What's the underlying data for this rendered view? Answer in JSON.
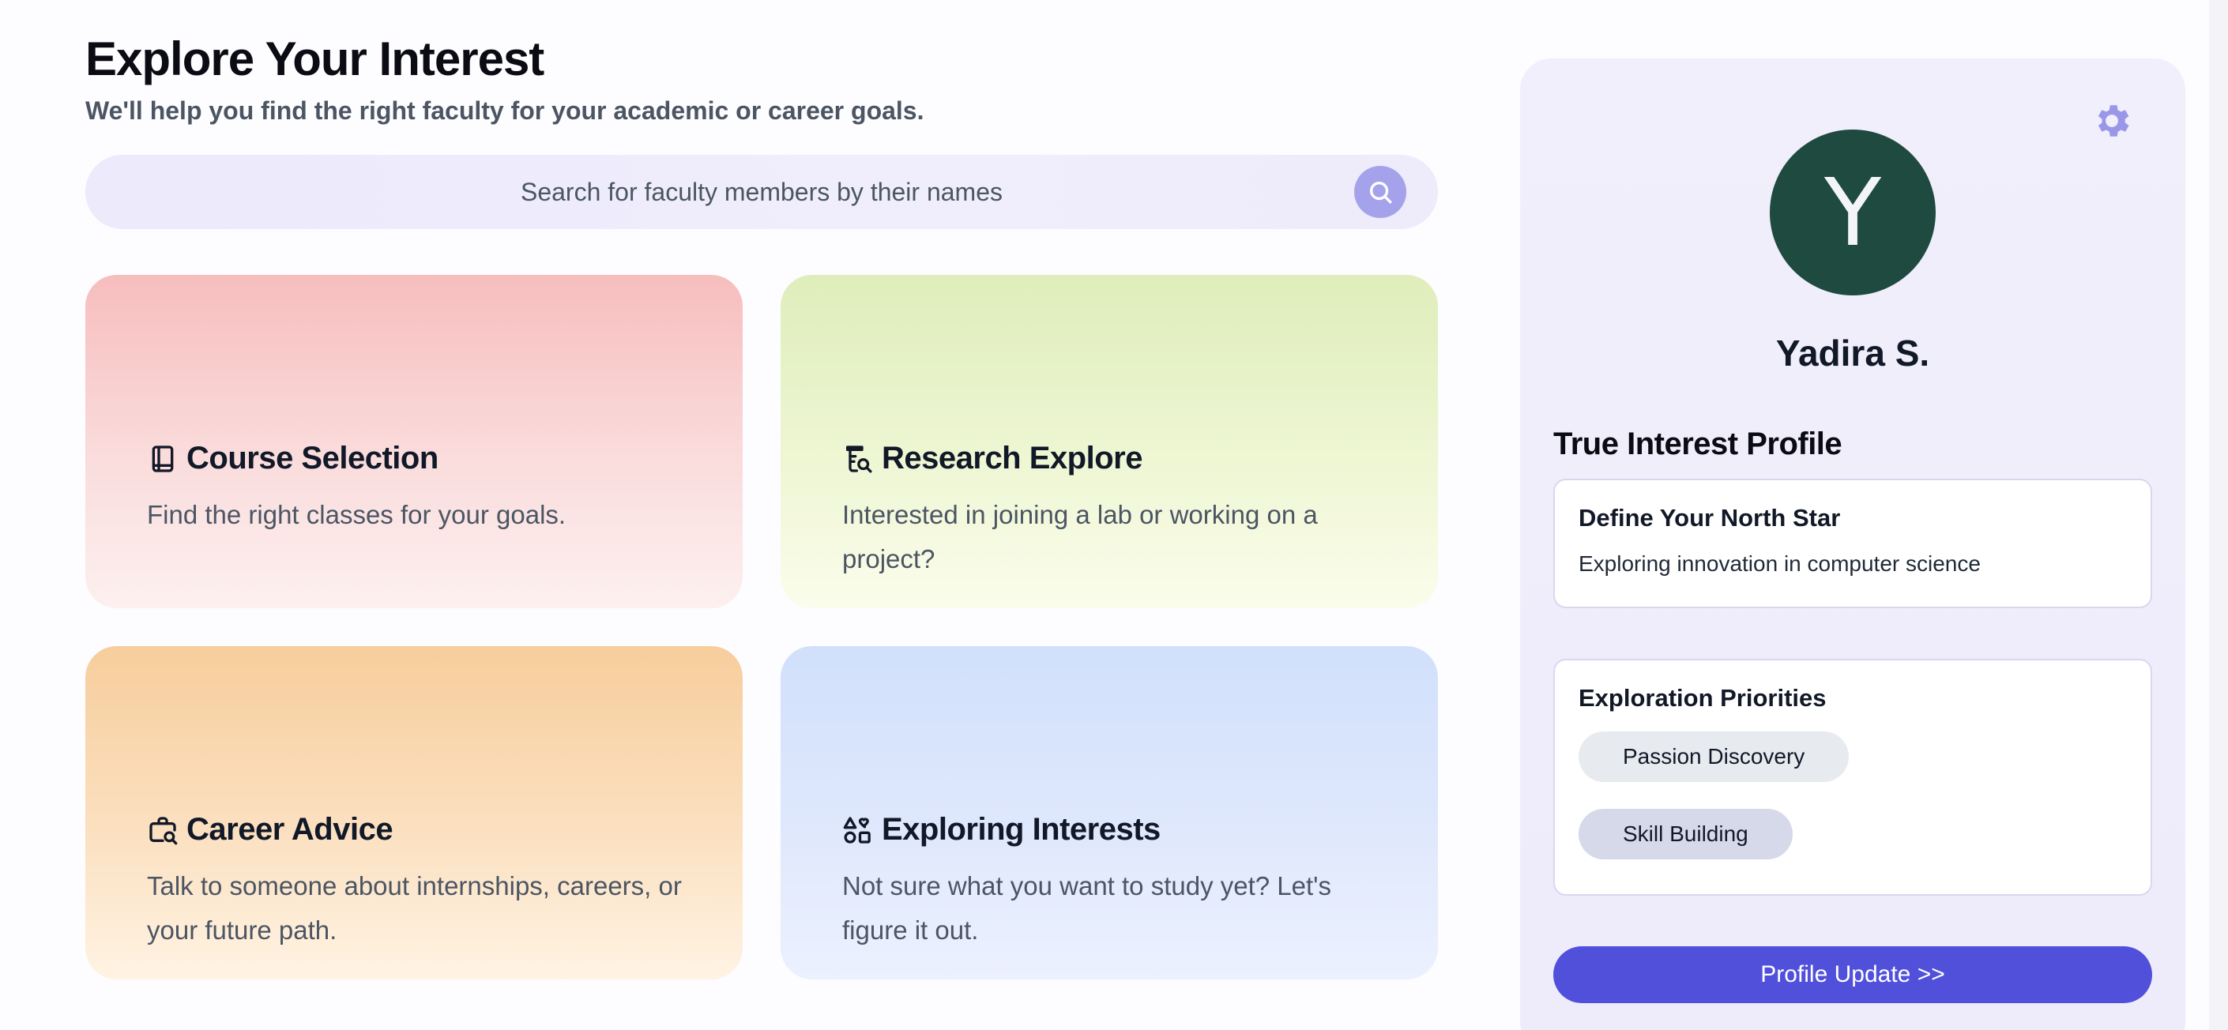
{
  "header": {
    "title": "Explore Your Interest",
    "subtitle": "We'll help you find the right faculty for your academic or career goals."
  },
  "search": {
    "placeholder": "Search for faculty members by their names",
    "icon": "search-icon"
  },
  "cards": [
    {
      "icon": "book-icon",
      "title": "Course Selection",
      "description": "Find the right classes for your goals."
    },
    {
      "icon": "research-search-icon",
      "title": "Research Explore",
      "description": "Interested in joining a lab or working on a project?"
    },
    {
      "icon": "briefcase-search-icon",
      "title": "Career Advice",
      "description": "Talk to someone about internships, careers, or your future path."
    },
    {
      "icon": "shapes-icon",
      "title": "Exploring Interests",
      "description": "Not sure what you want to study yet? Let's figure it out."
    }
  ],
  "profile": {
    "avatar_initial": "Y",
    "name": "Yadira S.",
    "section_title": "True Interest Profile",
    "north_star": {
      "title": "Define Your North Star",
      "text": "Exploring innovation in computer science"
    },
    "priorities": {
      "title": "Exploration Priorities",
      "items": [
        "Passion Discovery",
        "Skill Building"
      ]
    },
    "update_button": "Profile Update >>",
    "settings_icon": "gear-icon"
  },
  "colors": {
    "accent": "#5150db",
    "avatar_bg": "#1f4a40",
    "search_button": "#a5a2ec",
    "panel_bg": "#f1effb"
  }
}
